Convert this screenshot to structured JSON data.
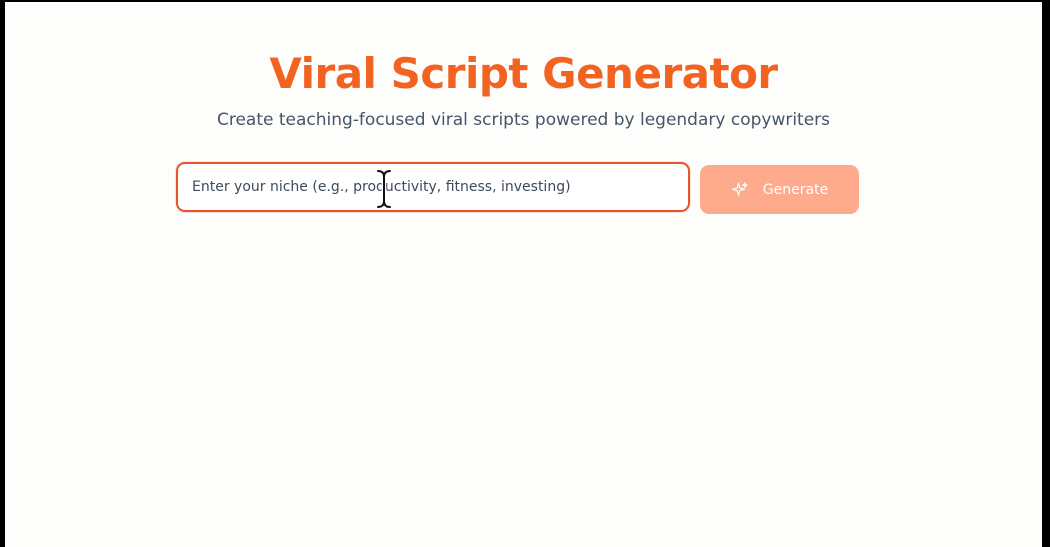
{
  "header": {
    "title": "Viral Script Generator",
    "subtitle": "Create teaching-focused viral scripts powered by legendary copywriters"
  },
  "form": {
    "niche_input": {
      "value": "",
      "placeholder": "Enter your niche (e.g., productivity, fitness, investing)"
    },
    "generate_button": {
      "label": "Generate",
      "icon": "sparkles-icon",
      "state": "disabled"
    }
  },
  "colors": {
    "accent": "#f26322",
    "input_border": "#e8552a",
    "button_disabled": "#fdab8c",
    "subtitle_text": "#475569",
    "background": "#fdfdfc"
  },
  "pointer": {
    "type": "text-cursor-icon"
  }
}
